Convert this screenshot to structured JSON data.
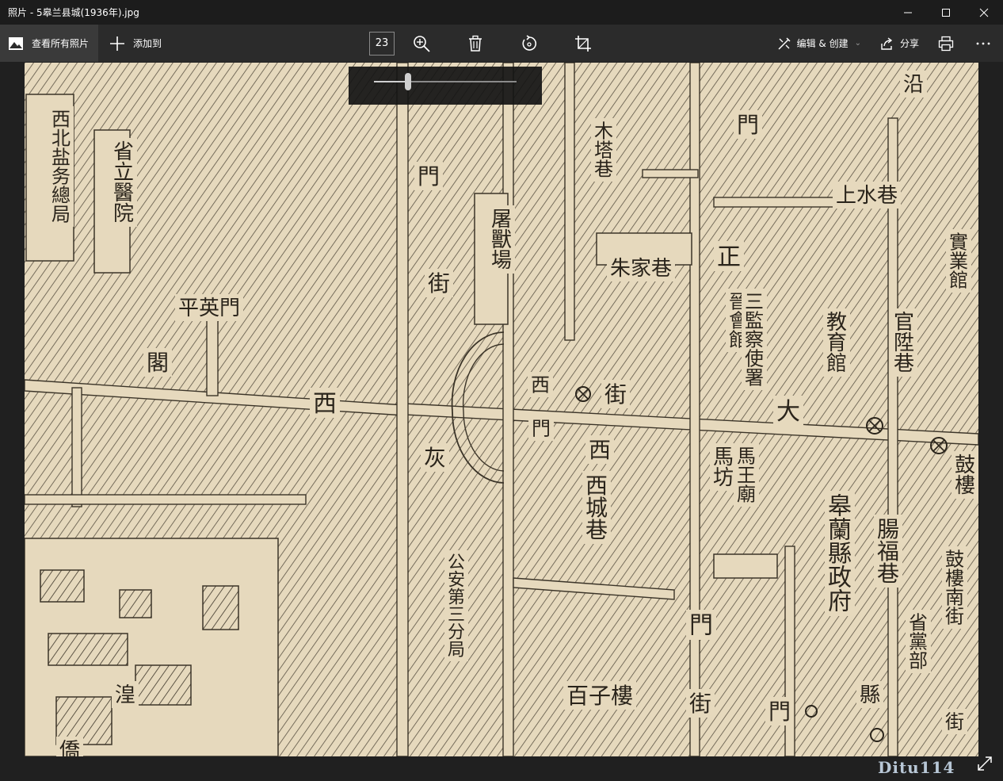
{
  "window": {
    "title": "照片 - 5皋兰县城(1936年).jpg"
  },
  "toolbar": {
    "view_all_label": "查看所有照片",
    "add_to_label": "添加到",
    "zoom_value": "23",
    "edit_create_label": "编辑 & 创建",
    "share_label": "分享"
  },
  "zoom_slider": {
    "level": 0.24
  },
  "map": {
    "labels": [
      "西北盐务總局",
      "省立醫院",
      "平英門",
      "閣",
      "西",
      "門",
      "街",
      "屠獸場",
      "木塔巷",
      "門",
      "上水巷",
      "朱家巷",
      "正",
      "晉會館",
      "三監察使署",
      "教育館",
      "官陞巷",
      "實業館",
      "西",
      "門",
      "街",
      "大",
      "西",
      "西城巷",
      "馬王廟",
      "馬坊",
      "皋蘭縣政府",
      "腸福巷",
      "鼓樓",
      "鼓樓南街",
      "省黨部",
      "灰",
      "公安第三分局",
      "門",
      "百子樓",
      "街",
      "門",
      "縣",
      "街",
      "湟",
      "沿",
      "僑"
    ]
  },
  "watermark": "Ditu114",
  "icons": {
    "view_all": "photos-icon",
    "add": "plus-icon",
    "zoom_in": "zoom-in-icon",
    "delete": "trash-icon",
    "rotate": "rotate-icon",
    "crop": "crop-icon",
    "edit": "edit-create-icon",
    "share": "share-icon",
    "print": "print-icon",
    "more": "more-icon"
  }
}
